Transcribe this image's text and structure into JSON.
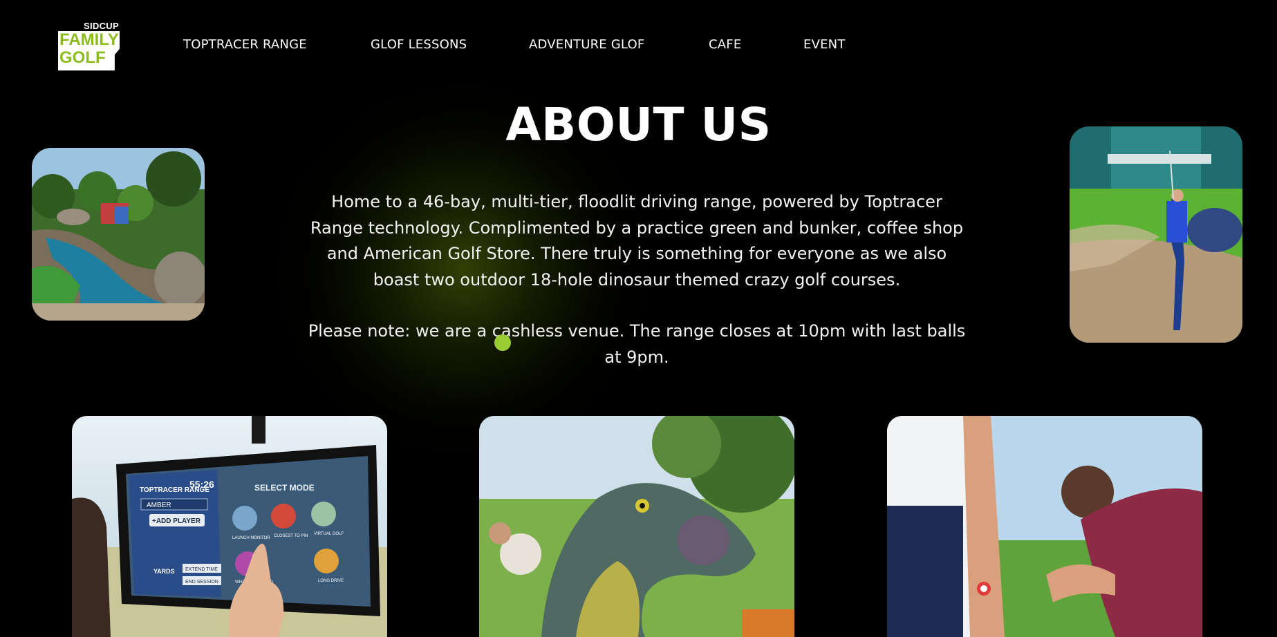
{
  "brand": {
    "top": "SIDCUP",
    "line1": "FAMILY",
    "line2": "GOLF",
    "accent": "#8cbd1d"
  },
  "nav": [
    {
      "label": "TOPTRACER RANGE"
    },
    {
      "label": "GLOF LESSONS"
    },
    {
      "label": "ADVENTURE GLOF"
    },
    {
      "label": "CAFE"
    },
    {
      "label": "EVENT"
    }
  ],
  "about": {
    "title": "ABOUT US",
    "paragraph1": "Home to a 46-bay, multi-tier, floodlit driving range, powered by Toptracer Range technology. Complimented by a practice green and bunker, coffee shop and American Golf Store. There truly is something for everyone as we also boast two outdoor 18-hole dinosaur themed crazy golf courses.",
    "paragraph2": "Please note: we are a cashless venue. The range closes at 10pm with last balls at 9pm."
  },
  "screen": {
    "brand": "TOPTRACER RANGE",
    "timer": "55:26",
    "player": "AMBER",
    "add_player": "+ADD PLAYER",
    "select_mode": "SELECT MODE",
    "modes": [
      "LAUNCH MONITOR",
      "CLOSEST TO PIN",
      "VIRTUAL GOLF",
      "WHAT'S IN MY BAG",
      "",
      "LONG DRIVE"
    ],
    "units": "YARDS",
    "extend": "EXTEND TIME",
    "end": "END SESSION"
  },
  "colors": {
    "background": "#000000",
    "glow": "#5a730a",
    "dot": "#9acd32"
  }
}
